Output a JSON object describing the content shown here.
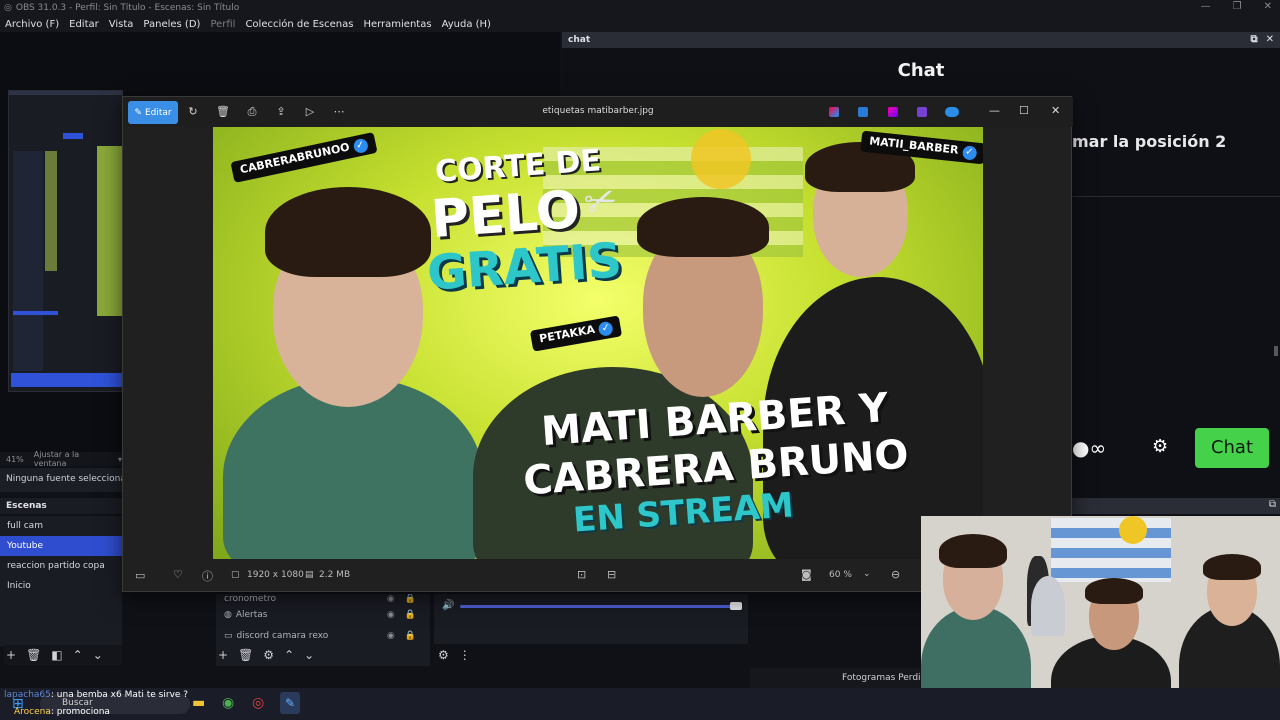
{
  "obs": {
    "title": "OBS 31.0.3 - Perfil: Sin Título - Escenas: Sin Título",
    "menu": [
      "Archivo (F)",
      "Editar",
      "Vista",
      "Paneles (D)",
      "Perfil",
      "Colección de Escenas",
      "Herramientas",
      "Ayuda (H)"
    ],
    "zoom": "41%",
    "zoom_mode": "Ajustar a la ventana",
    "no_source": "Ninguna fuente seleccionada",
    "scenes_header": "Escenas",
    "scenes": [
      "full cam",
      "Youtube",
      "reaccion partido copa",
      "Inicio"
    ],
    "active_scene": "Youtube",
    "sources": [
      "cronometro",
      "Alertas",
      "discord camara rexo"
    ],
    "status": "Fotogramas Perdidos"
  },
  "chat": {
    "dock_title": "chat",
    "title": "Chat",
    "message": "mar la posición 2",
    "send_label": "Chat"
  },
  "viewer": {
    "edit_label": "Editar",
    "file_name": "etiquetas matibarber.jpg",
    "dimensions": "1920 x 1080",
    "size": "2.2 MB",
    "zoom": "60 %"
  },
  "thumbnail": {
    "tag_left": "CABRERABRUNOO",
    "tag_right": "MATII_BARBER",
    "tag_center": "PETAKKA",
    "headline1": "CORTE DE",
    "headline2": "PELO",
    "headline3": "GRATIS",
    "title1": "MATI BARBER Y",
    "title2": "CABRERA BRUNO",
    "title3": "EN STREAM"
  },
  "taskbar": {
    "chat_line1_user": "lapacha65",
    "chat_line1_text": "una bemba x6 Mati te sirve ?",
    "chat_line2_user": "Arocena",
    "chat_line2_text": "promociona",
    "search": "Buscar"
  },
  "colors": {
    "accent_blue": "#2f4ecf",
    "chat_green": "#45d14a",
    "edit_blue": "#3a8ee6"
  }
}
